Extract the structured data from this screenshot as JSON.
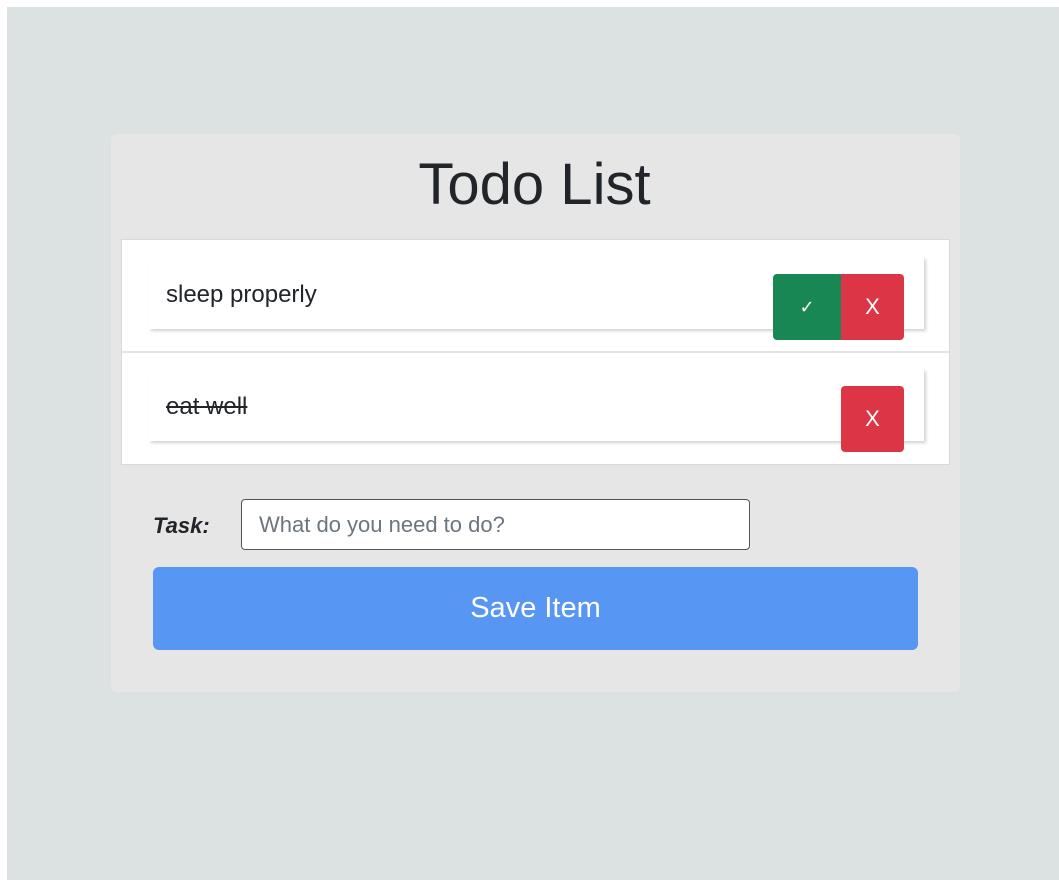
{
  "app": {
    "title": "Todo List"
  },
  "todos": [
    {
      "text": "sleep properly",
      "completed": false,
      "complete_label": "✓",
      "delete_label": "X"
    },
    {
      "text": "eat well",
      "completed": true,
      "delete_label": "X"
    }
  ],
  "form": {
    "task_label": "Task:",
    "task_value": "",
    "task_placeholder": "What do you need to do?",
    "save_label": "Save Item"
  },
  "colors": {
    "page_background": "#dce1e1",
    "card_background": "#e6e6e6",
    "complete_button": "#198754",
    "delete_button": "#dc3545",
    "save_button": "#5796f2"
  }
}
